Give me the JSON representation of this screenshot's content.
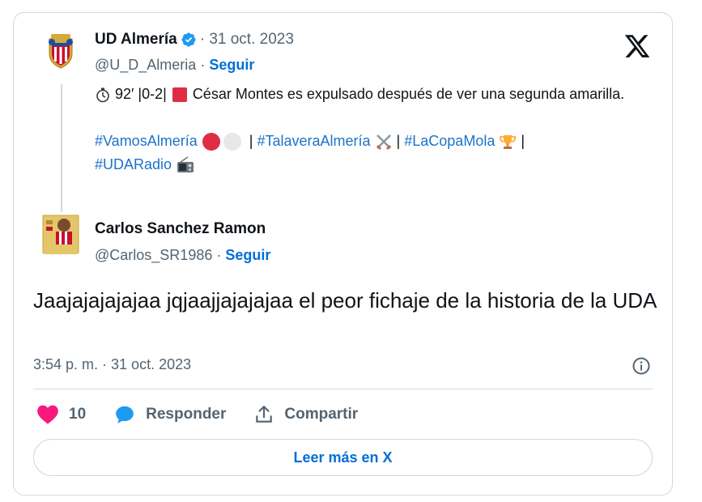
{
  "colors": {
    "link": "#006fd6",
    "hashtag": "#1d73c9",
    "muted": "#536471",
    "border": "#cfd9de",
    "like": "#f91880"
  },
  "quoted_tweet": {
    "author_name": "UD Almería",
    "separator_date": "· 31 oct. 2023",
    "handle": "@U_D_Almeria",
    "handle_sep": " · ",
    "follow_label": "Seguir",
    "text_line1": "92′ |0-2|",
    "text_line1b": "César Montes es expulsado después de ver una segunda amarilla.",
    "hashtags": {
      "h1": "#VamosAlmería",
      "sep1": "|",
      "h2": "#TalaveraAlmería",
      "sep2": "|",
      "h3": "#LaCopaMola",
      "sep3": "|",
      "h4": "#UDARadio"
    }
  },
  "reply_tweet": {
    "author_name": "Carlos Sanchez Ramon",
    "handle": "@Carlos_SR1986",
    "handle_sep": " · ",
    "follow_label": "Seguir",
    "text": "Jaajajajajajaa jqjaajjajajajaa el peor fichaje de la historia de la UDA",
    "timestamp": "3:54 p. m. · 31 oct. 2023"
  },
  "actions": {
    "like_count": "10",
    "reply_label": "Responder",
    "share_label": "Compartir"
  },
  "read_more_label": "Leer más en X",
  "icons": [
    "x-logo-icon",
    "verified-badge-icon",
    "stopwatch-icon",
    "red-square-icon",
    "red-circle-icon",
    "white-circle-icon",
    "crossed-swords-icon",
    "trophy-icon",
    "radio-icon",
    "info-icon",
    "heart-icon",
    "reply-bubble-icon",
    "share-icon"
  ]
}
